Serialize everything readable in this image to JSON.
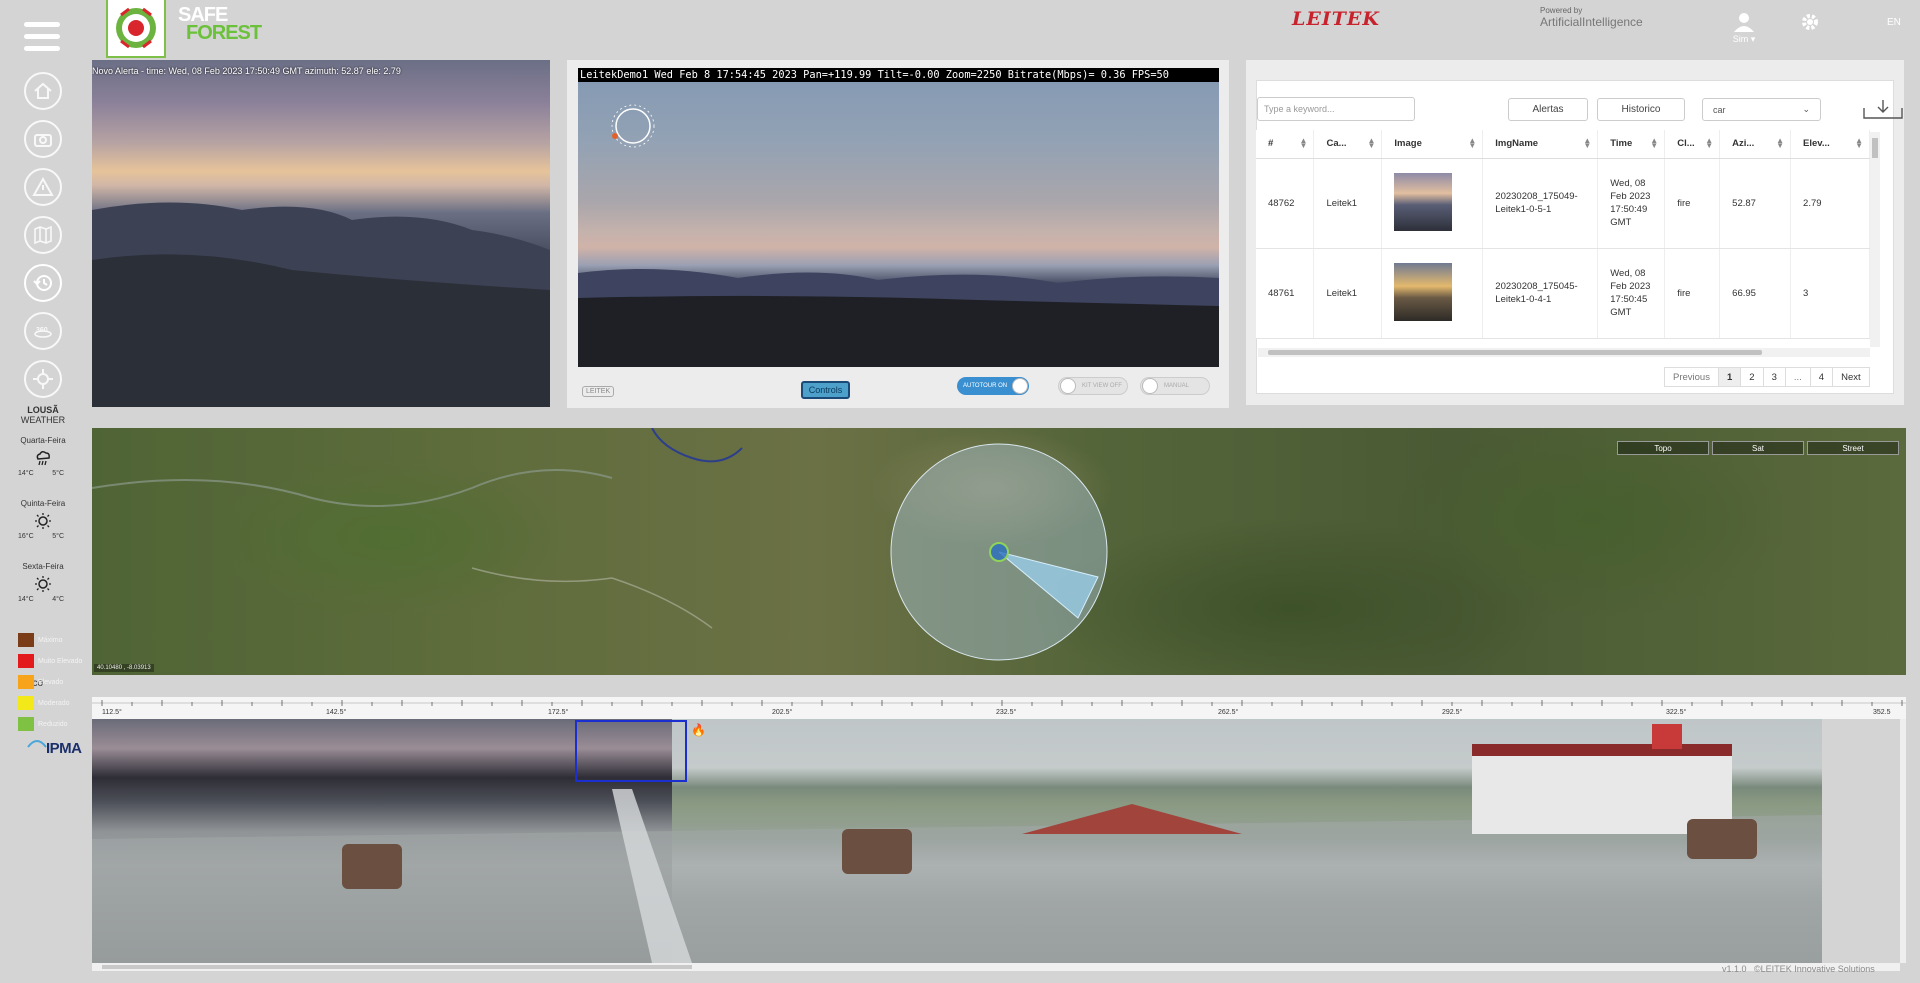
{
  "header": {
    "logo_line1": "SAFE",
    "logo_line2": "FOREST",
    "brand": "LEITEK",
    "powered_by": "Powered by",
    "ai_label": "ArtificialIntelligence",
    "user_name": "Sim",
    "language": "EN"
  },
  "sidebar": {
    "icons": [
      "home-icon",
      "camera-icon",
      "alert-icon",
      "map-icon",
      "history-icon",
      "panorama-360-icon",
      "gps-icon"
    ],
    "badge_360": "360"
  },
  "weather": {
    "location": "LOUSÃ",
    "subtitle": "WEATHER",
    "days": [
      {
        "name": "Quarta-Feira",
        "icon": "rain-icon",
        "max": "14°C",
        "min": "5°C"
      },
      {
        "name": "Quinta-Feira",
        "icon": "sun-icon",
        "max": "16°C",
        "min": "5°C"
      },
      {
        "name": "Sexta-Feira",
        "icon": "sun-icon",
        "max": "14°C",
        "min": "4°C"
      }
    ],
    "risk_title": "Risco",
    "risk_levels": [
      {
        "label": "Máximo",
        "color": "#7a3d17"
      },
      {
        "label": "Muito Elevado",
        "color": "#e31a1c"
      },
      {
        "label": "Elevado",
        "color": "#f7a41b"
      },
      {
        "label": "Moderado",
        "color": "#f2e81a"
      },
      {
        "label": "Reduzido",
        "color": "#7ec143"
      }
    ],
    "provider": "IPMA"
  },
  "alert_image": {
    "caption": "Novo Alerta - time: Wed, 08 Feb 2023 17:50:49 GMT azimuth: 52.87 ele: 2.79"
  },
  "live": {
    "osd": "LeitekDemo1 Wed Feb  8 17:54:45 2023 Pan=+119.99 Tilt=-0.00 Zoom=2250 Bitrate(Mbps)= 0.36 FPS=50",
    "controls_label": "Controls",
    "cam_logo": "LEITEK",
    "autotour_label": "AUTOTOUR ON",
    "kit_label": "KIT VIEW OFF",
    "manual_label": "MANUAL"
  },
  "alerts_table": {
    "search_placeholder": "Type a keyword...",
    "tab_alerts": "Alertas",
    "tab_history": "Historico",
    "filter_value": "car",
    "columns": [
      "#",
      "Ca...",
      "Image",
      "ImgName",
      "Time",
      "Cl...",
      "Azi...",
      "Elev..."
    ],
    "rows": [
      {
        "id": "48762",
        "camera": "Leitek1",
        "imgname": "20230208_175049-Leitek1-0-5-1",
        "time": "Wed, 08 Feb 2023 17:50:49 GMT",
        "class": "fire",
        "azimuth": "52.87",
        "elevation": "2.79"
      },
      {
        "id": "48761",
        "camera": "Leitek1",
        "imgname": "20230208_175045-Leitek1-0-4-1",
        "time": "Wed, 08 Feb 2023 17:50:45 GMT",
        "class": "fire",
        "azimuth": "66.95",
        "elevation": "3"
      }
    ],
    "pagination": {
      "previous": "Previous",
      "pages": [
        "1",
        "2",
        "3",
        "...",
        "4"
      ],
      "next": "Next"
    }
  },
  "map": {
    "buttons": [
      "Topo",
      "Sat",
      "Street"
    ],
    "coords": "40.10480 , -8.03913"
  },
  "panorama": {
    "ruler_labels": [
      "112.5°",
      "142.5°",
      "172.5°",
      "202.5°",
      "232.5°",
      "262.5°",
      "292.5°",
      "322.5°",
      "352.5"
    ]
  },
  "footer": {
    "version": "v1.1.0",
    "copyright": "©LEITEK Innovative Solutions"
  }
}
